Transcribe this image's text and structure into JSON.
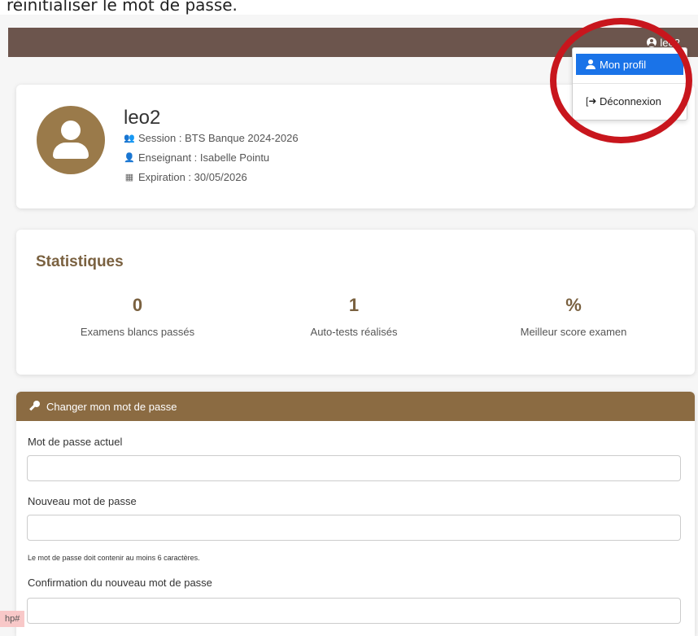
{
  "caption": "réinitialiser le mot de passe.",
  "nav": {
    "username": "leo2",
    "menu": {
      "profile_label": "Mon profil",
      "logout_label": "Déconnexion"
    }
  },
  "profile": {
    "name": "leo2",
    "session": "Session : BTS Banque 2024-2026",
    "teacher": "Enseignant : Isabelle Pointu",
    "expiration": "Expiration : 30/05/2026"
  },
  "stats": {
    "title": "Statistiques",
    "items": [
      {
        "value": "0",
        "label": "Examens blancs passés"
      },
      {
        "value": "1",
        "label": "Auto-tests réalisés"
      },
      {
        "value": "%",
        "label": "Meilleur score examen"
      }
    ]
  },
  "password_form": {
    "header": "Changer mon mot de passe",
    "current_label": "Mot de passe actuel",
    "current_value": "",
    "new_label": "Nouveau mot de passe",
    "new_value": "",
    "hint": "Le mot de passe doit contenir au moins 6 caractères.",
    "confirm_label": "Confirmation du nouveau mot de passe",
    "confirm_value": ""
  },
  "debug": "hp#",
  "colors": {
    "topbar": "#6c554d",
    "accent": "#8b6b42",
    "menu_active": "#1a73e8",
    "highlight": "#c8161d"
  }
}
